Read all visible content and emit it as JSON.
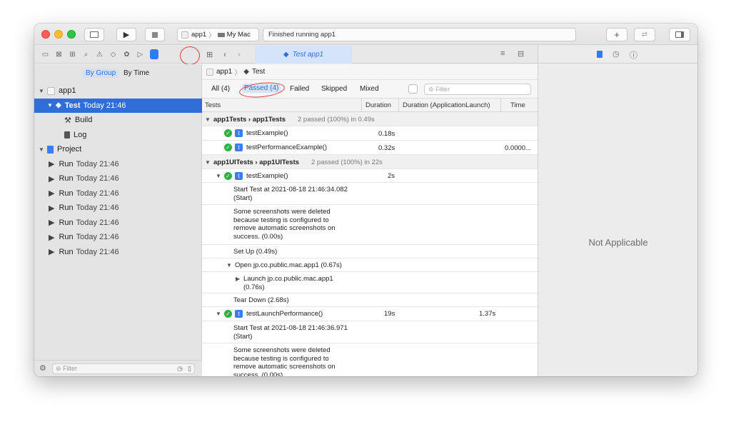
{
  "toolbar": {
    "scheme_target": "app1",
    "scheme_destination": "My Mac",
    "activity_status": "Finished running app1"
  },
  "editor_tab": {
    "title": "Test app1"
  },
  "navigator": {
    "segments": [
      "By Group",
      "By Time"
    ],
    "items": [
      {
        "label": "app1",
        "time": "",
        "level": 0,
        "icon": "app-icon",
        "expanded": true
      },
      {
        "label": "Test",
        "time": "Today 21:46",
        "level": 1,
        "icon": "test-diamond-icon",
        "expanded": true,
        "selected": true
      },
      {
        "label": "Build",
        "time": "",
        "level": 2,
        "icon": "hammer-icon"
      },
      {
        "label": "Log",
        "time": "",
        "level": 2,
        "icon": "log-icon"
      },
      {
        "label": "Project",
        "time": "",
        "level": 0,
        "icon": "document-icon",
        "expanded": true
      },
      {
        "label": "Run",
        "time": "Today 21:46",
        "level": 1,
        "icon": "play-icon"
      },
      {
        "label": "Run",
        "time": "Today 21:46",
        "level": 1,
        "icon": "play-icon"
      },
      {
        "label": "Run",
        "time": "Today 21:46",
        "level": 1,
        "icon": "play-icon"
      },
      {
        "label": "Run",
        "time": "Today 21:46",
        "level": 1,
        "icon": "play-icon"
      },
      {
        "label": "Run",
        "time": "Today 21:46",
        "level": 1,
        "icon": "play-icon"
      },
      {
        "label": "Run",
        "time": "Today 21:46",
        "level": 1,
        "icon": "play-icon"
      },
      {
        "label": "Run",
        "time": "Today 21:46",
        "level": 1,
        "icon": "play-icon"
      }
    ],
    "filter_placeholder": "Filter"
  },
  "report": {
    "breadcrumb": [
      "app1",
      "Test"
    ],
    "filters": [
      "All (4)",
      "Passed (4)",
      "Failed",
      "Skipped",
      "Mixed"
    ],
    "selected_filter": "Passed (4)",
    "search_placeholder": "Filter",
    "columns": [
      "Tests",
      "Duration",
      "Duration (ApplicationLaunch)",
      "Time"
    ],
    "groups": [
      {
        "name": "app1Tests › app1Tests",
        "summary": "2 passed (100%) in 0.49s"
      },
      {
        "name": "app1UITests › app1UITests",
        "summary": "2 passed (100%) in 22s"
      }
    ],
    "tests": [
      {
        "name": "testExample()",
        "duration": "0.18s",
        "launch": "",
        "time": ""
      },
      {
        "name": "testPerformanceExample()",
        "duration": "0.32s",
        "launch": "",
        "time": "0.0000..."
      },
      {
        "name": "testExample()",
        "duration": "2s",
        "launch": "",
        "time": ""
      },
      {
        "name": "testLaunchPerformance()",
        "duration": "19s",
        "launch": "1.37s",
        "time": ""
      }
    ],
    "activities": {
      "start1": "Start Test at 2021-08-18 21:46:34.082 (Start)",
      "screens1": "Some screenshots were deleted because testing is configured to remove automatic screenshots on success. (0.00s)",
      "setup": "Set Up (0.49s)",
      "open": "Open jp.co.public.mac.app1 (0.67s)",
      "launch": "Launch jp.co.public.mac.app1 (0.76s)",
      "teardown": "Tear Down (2.68s)",
      "start2": "Start Test at 2021-08-18 21:46:36.971 (Start)",
      "screens2": "Some screenshots were deleted because testing is configured to remove automatic screenshots on success. (0.00s)"
    }
  },
  "inspector": {
    "empty_text": "Not Applicable"
  },
  "colors": {
    "accent": "#2f6ed9",
    "pass": "#2fb141",
    "annotation": "#e23b3b"
  }
}
